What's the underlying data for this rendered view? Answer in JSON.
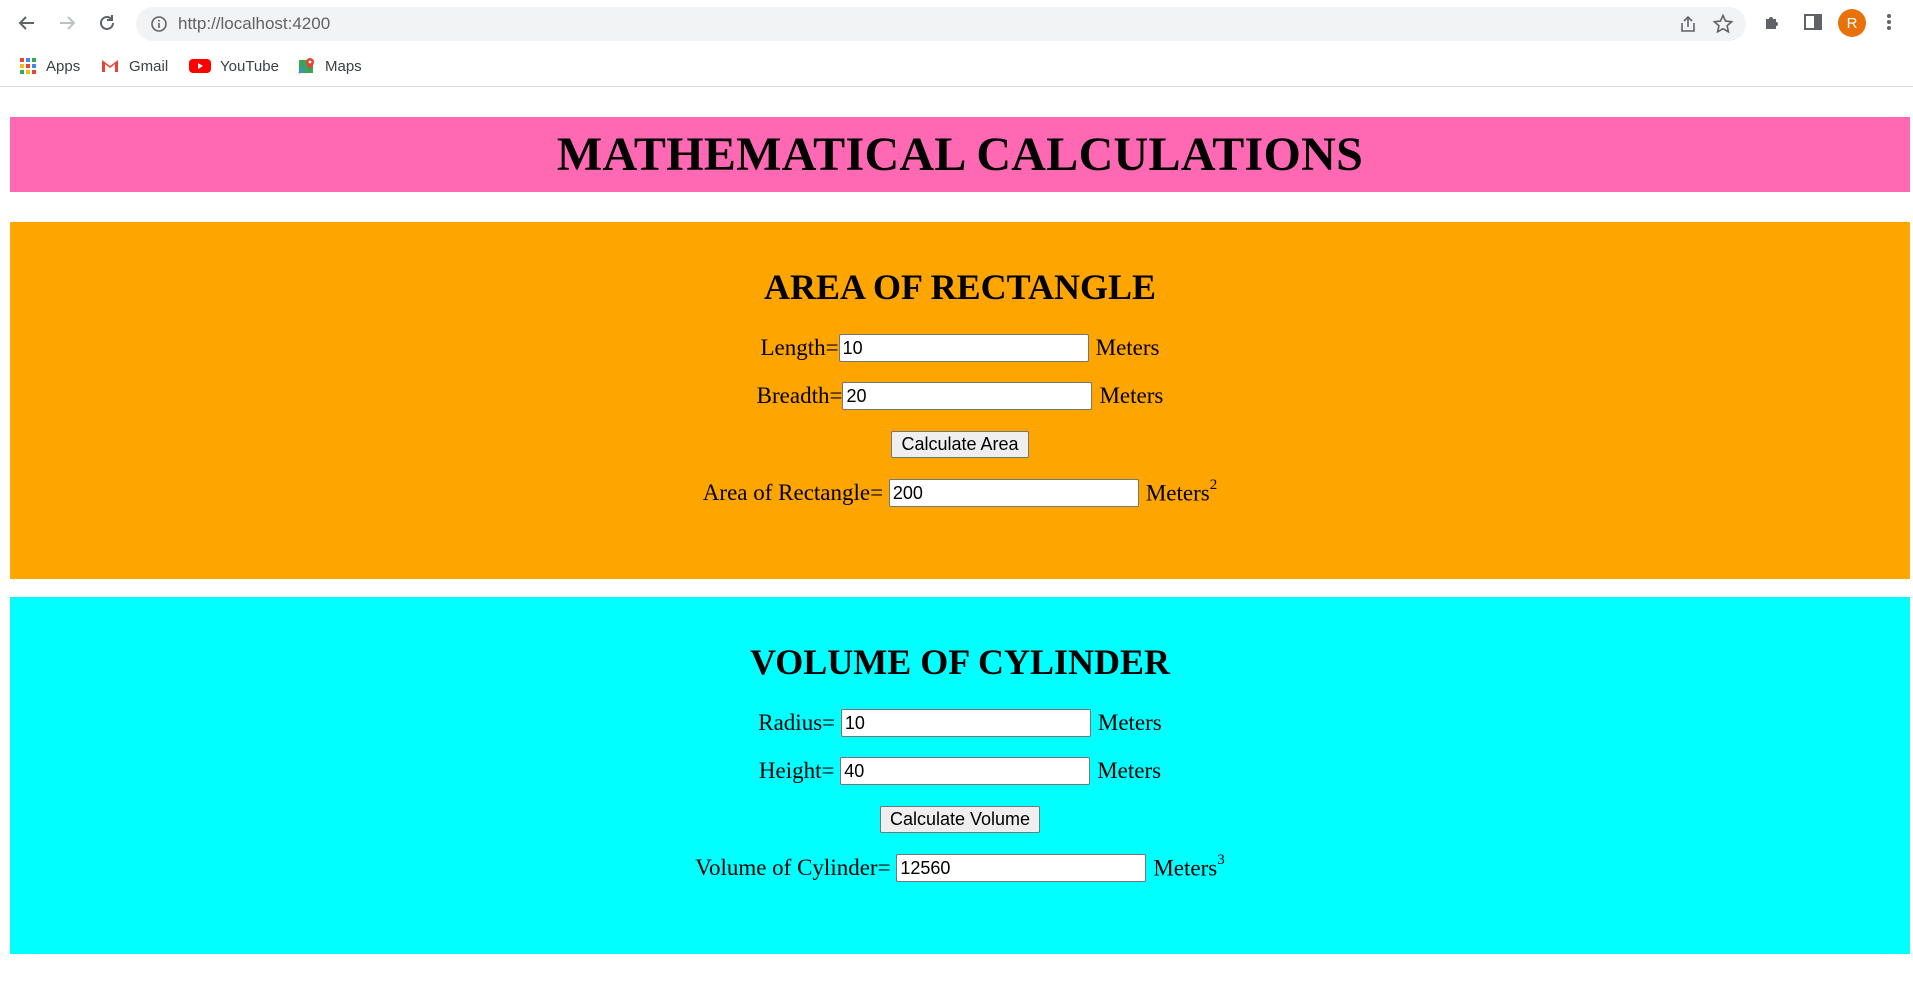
{
  "browser": {
    "url": "http://localhost:4200",
    "avatar_initial": "R",
    "bookmarks": [
      "Apps",
      "Gmail",
      "YouTube",
      "Maps"
    ]
  },
  "page": {
    "title": "MATHEMATICAL CALCULATIONS",
    "header_color": "#ff69b4"
  },
  "rectangle": {
    "heading": "AREA OF RECTANGLE",
    "bg_color": "#ffa500",
    "length_label": "Length=",
    "length_value": "10",
    "breadth_label": "Breadth=",
    "breadth_value": "20",
    "unit": "Meters",
    "button": "Calculate Area",
    "result_label": "Area of Rectangle=",
    "result_value": "200",
    "result_unit": "Meters",
    "result_exponent": "2"
  },
  "cylinder": {
    "heading": "VOLUME OF CYLINDER",
    "bg_color": "#00ffff",
    "radius_label": "Radius=",
    "radius_value": "10",
    "height_label": "Height=",
    "height_value": "40",
    "unit": "Meters",
    "button": "Calculate Volume",
    "result_label": "Volume of Cylinder=",
    "result_value": "12560",
    "result_unit": "Meters",
    "result_exponent": "3"
  }
}
